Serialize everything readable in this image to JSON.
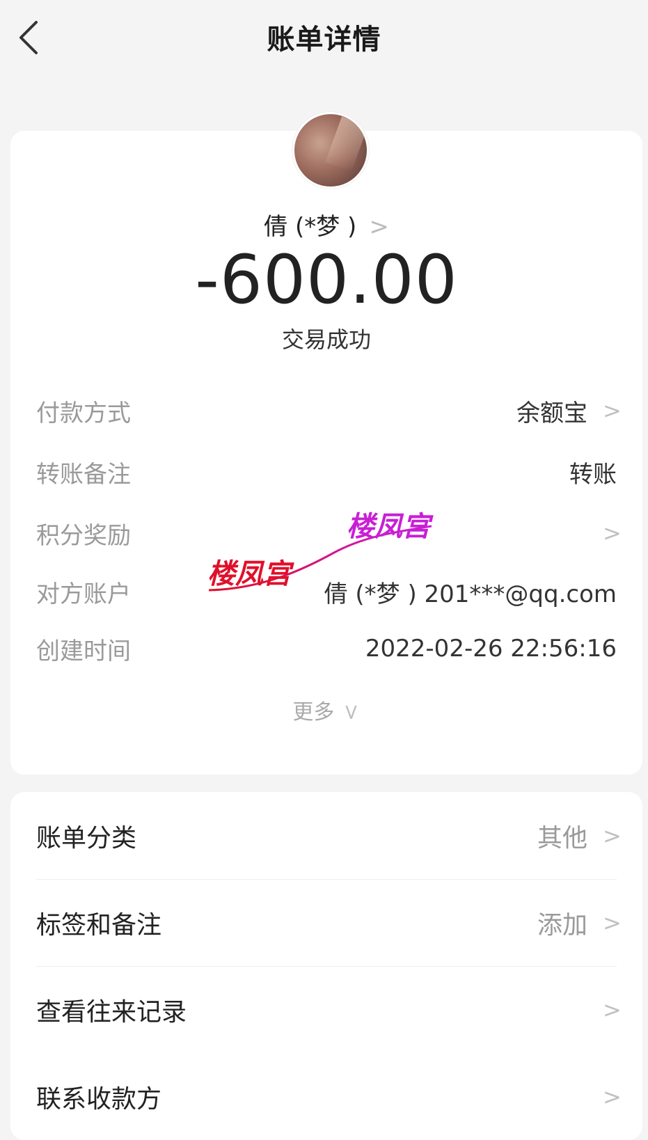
{
  "header": {
    "title": "账单详情"
  },
  "summary": {
    "payee": "倩 (*梦 )",
    "amount": "-600.00",
    "status": "交易成功"
  },
  "details": [
    {
      "label": "付款方式",
      "value": "余额宝",
      "chevron": true
    },
    {
      "label": "转账备注",
      "value": "转账",
      "chevron": false
    },
    {
      "label": "积分奖励",
      "value": "",
      "chevron": true
    },
    {
      "label": "对方账户",
      "value": "倩 (*梦 ) 201***@qq.com",
      "chevron": false
    },
    {
      "label": "创建时间",
      "value": "2022-02-26 22:56:16",
      "chevron": false
    }
  ],
  "more_label": "更多",
  "actions": [
    {
      "label": "账单分类",
      "value": "其他"
    },
    {
      "label": "标签和备注",
      "value": "添加"
    },
    {
      "label": "查看往来记录",
      "value": ""
    },
    {
      "label": "联系收款方",
      "value": ""
    }
  ],
  "watermark": {
    "text": "楼凤宫",
    "colors": [
      "#e0102a",
      "#c81fd6"
    ]
  },
  "icons": {
    "back": "back-arrow-icon",
    "chevron": "chevron-right-icon",
    "more": "chevron-down-icon"
  }
}
